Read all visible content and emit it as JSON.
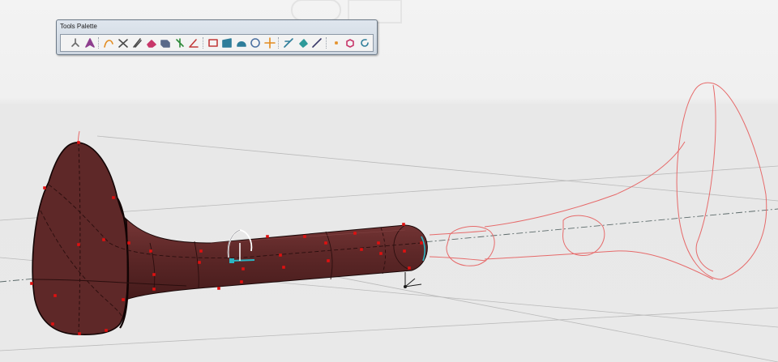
{
  "palette": {
    "title": "Tools Palette",
    "tools": [
      {
        "name": "axis-system-icon",
        "color": "#6a6a6a"
      },
      {
        "name": "compass-icon",
        "color": "#8e3e8e"
      },
      {
        "sep": true
      },
      {
        "name": "sketch-curve-icon",
        "color": "#e38b1e"
      },
      {
        "name": "scissors-icon",
        "color": "#4a4a4a"
      },
      {
        "name": "tweezers-icon",
        "color": "#4a4a4a"
      },
      {
        "name": "eraser-icon",
        "color": "#c8376a"
      },
      {
        "name": "solid-box-icon",
        "color": "#5a6a8a"
      },
      {
        "name": "snap-point-icon",
        "color": "#2d8a3a"
      },
      {
        "name": "angle-tool-icon",
        "color": "#c23b3b"
      },
      {
        "sep": true
      },
      {
        "name": "select-rectangle-icon",
        "color": "#c23b3b"
      },
      {
        "name": "surface-patch-icon",
        "color": "#2e7d9a"
      },
      {
        "name": "dome-icon",
        "color": "#2e7d9a"
      },
      {
        "name": "sphere-tool-icon",
        "color": "#4a6fa0"
      },
      {
        "name": "move-arrows-icon",
        "color": "#e38b1e"
      },
      {
        "sep": true
      },
      {
        "name": "ruler-pen-icon",
        "color": "#2e7d9a"
      },
      {
        "name": "fill-icon",
        "color": "#2e9a9a"
      },
      {
        "name": "line-icon",
        "color": "#3a3a6a"
      },
      {
        "sep": true
      },
      {
        "name": "point-icon",
        "color": "#e38b1e"
      },
      {
        "name": "cube-view-icon",
        "color": "#c8376a"
      },
      {
        "name": "refresh-icon",
        "color": "#2e7d9a"
      }
    ]
  },
  "scene": {
    "model_color": "#5e2828",
    "construction_color": "#e66a6a",
    "control_point_color": "#e01010",
    "manipulator_color": "#2bb5c2"
  }
}
